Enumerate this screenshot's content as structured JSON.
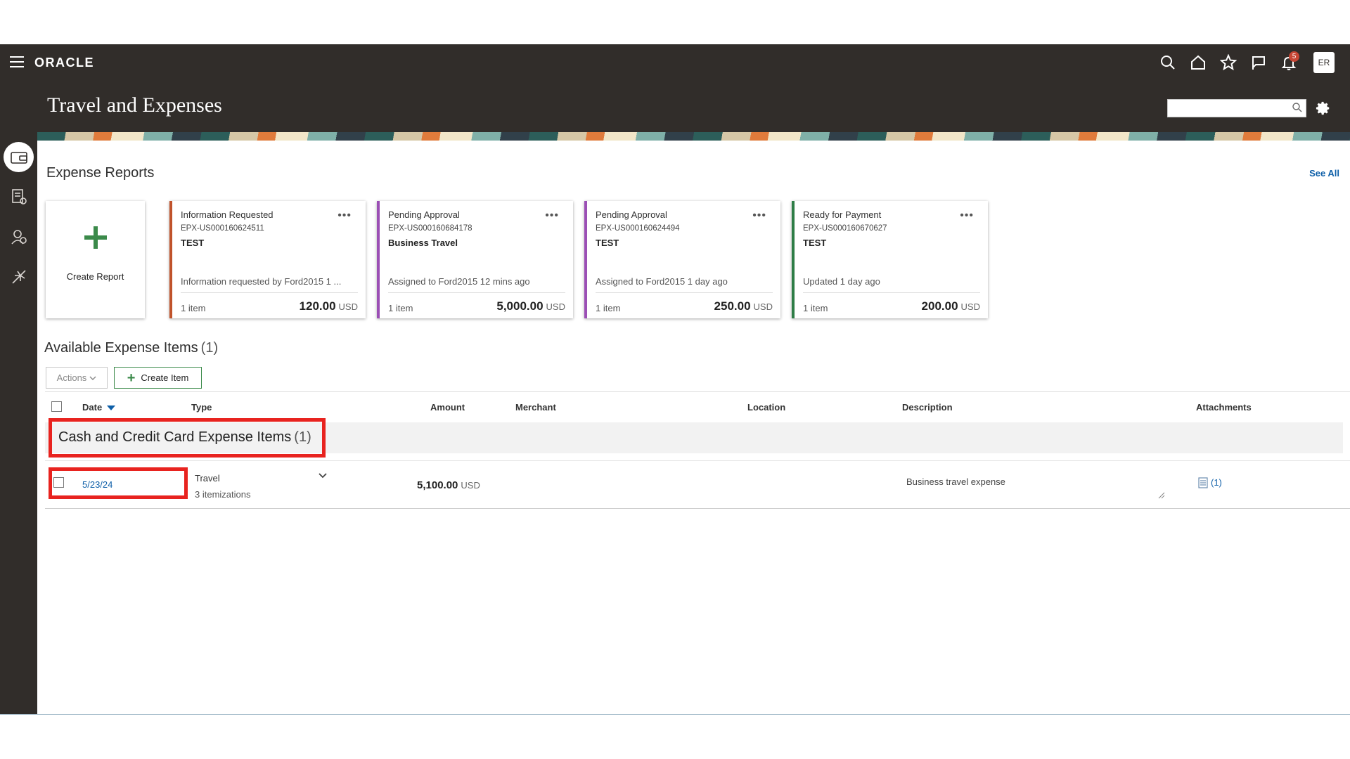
{
  "header": {
    "brand": "ORACLE",
    "page_title": "Travel and Expenses",
    "notification_count": "5",
    "avatar_initials": "ER",
    "search_placeholder": ""
  },
  "expense_reports": {
    "section_title": "Expense Reports",
    "see_all_label": "See All",
    "create_label": "Create Report",
    "cards": [
      {
        "status": "Information Requested",
        "id": "EPX-US000160624511",
        "name": "TEST",
        "note": "Information requested by Ford2015 1 ...",
        "items": "1 item",
        "amount": "120.00",
        "currency": "USD",
        "accent": "#c0532b"
      },
      {
        "status": "Pending Approval",
        "id": "EPX-US000160684178",
        "name": "Business Travel",
        "note": "Assigned to Ford2015 12 mins ago",
        "items": "1 item",
        "amount": "5,000.00",
        "currency": "USD",
        "accent": "#9b4fb5"
      },
      {
        "status": "Pending Approval",
        "id": "EPX-US000160624494",
        "name": "TEST",
        "note": "Assigned to Ford2015 1 day ago",
        "items": "1 item",
        "amount": "250.00",
        "currency": "USD",
        "accent": "#9b4fb5"
      },
      {
        "status": "Ready for Payment",
        "id": "EPX-US000160670627",
        "name": "TEST",
        "note": "Updated 1 day ago",
        "items": "1 item",
        "amount": "200.00",
        "currency": "USD",
        "accent": "#2e7d46"
      }
    ]
  },
  "available_items": {
    "title": "Available Expense Items",
    "count": "(1)",
    "actions_label": "Actions",
    "create_item_label": "Create Item",
    "columns": [
      "Date",
      "Type",
      "Amount",
      "Merchant",
      "Location",
      "Description",
      "Attachments"
    ],
    "group": {
      "label": "Cash and Credit Card Expense Items",
      "count": "(1)"
    },
    "rows": [
      {
        "date": "5/23/24",
        "type": "Travel",
        "itemizations": "3 itemizations",
        "amount": "5,100.00",
        "currency": "USD",
        "merchant": "",
        "location": "",
        "description": "Business travel expense",
        "attachments": "(1)"
      }
    ]
  }
}
